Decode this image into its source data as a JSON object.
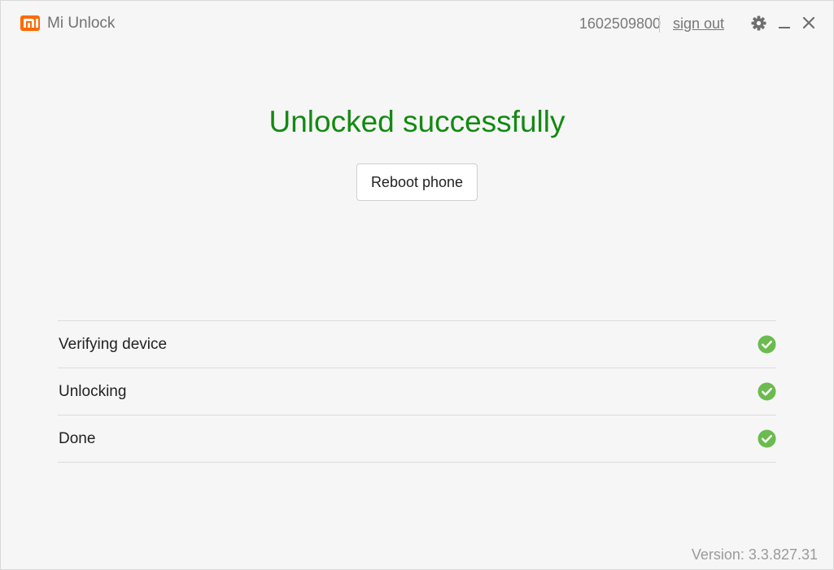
{
  "app": {
    "title": "Mi Unlock",
    "brand_color": "#ff6a00"
  },
  "account": {
    "id": "1602509800",
    "signout_label": "sign out"
  },
  "window_controls": {
    "settings_icon": "gear-icon",
    "minimize_icon": "minimize-icon",
    "close_icon": "close-icon"
  },
  "main": {
    "headline": "Unlocked successfully",
    "headline_color": "#128a12",
    "reboot_label": "Reboot phone"
  },
  "steps": [
    {
      "label": "Verifying device",
      "status": "done"
    },
    {
      "label": "Unlocking",
      "status": "done"
    },
    {
      "label": "Done",
      "status": "done"
    }
  ],
  "status_color": "#6bbb4f",
  "footer": {
    "version": "Version: 3.3.827.31"
  }
}
